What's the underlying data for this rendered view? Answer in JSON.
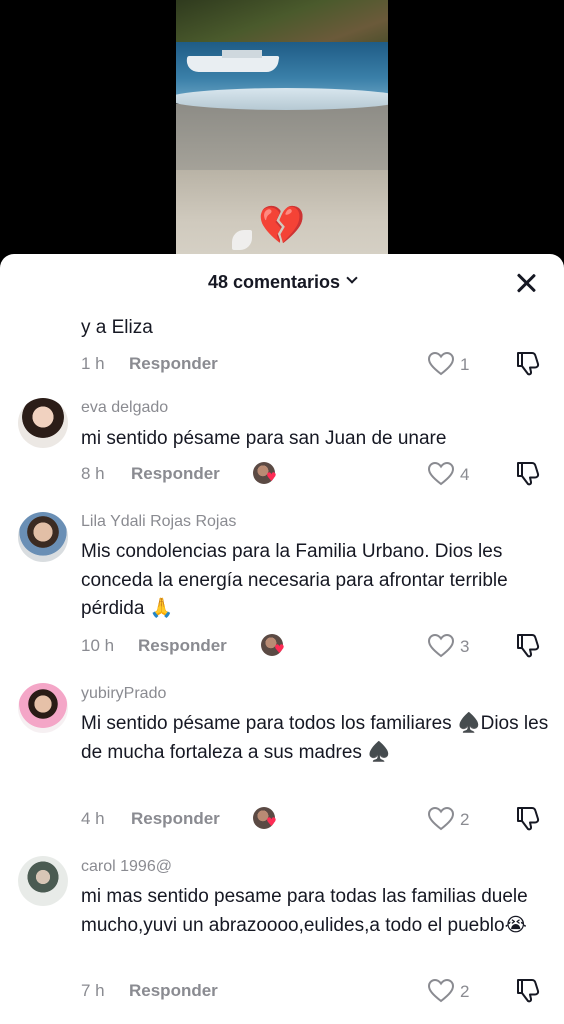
{
  "header": {
    "comment_count": "48 comentarios"
  },
  "video": {
    "overlay_emoji": "💔"
  },
  "comments": [
    {
      "username": "",
      "text": "y a Eliza",
      "time": "1 h",
      "reply": "Responder",
      "likes": "1",
      "creator_liked": false
    },
    {
      "username": "eva delgado",
      "text": "mi sentido pésame para san Juan de unare",
      "time": "8 h",
      "reply": "Responder",
      "likes": "4",
      "creator_liked": true
    },
    {
      "username": "Lila Ydali Rojas Rojas",
      "text": "Mis condolencias para la Familia Urbano. Dios les conceda la energía necesaria para afrontar terrible pérdida 🙏",
      "time": "10 h",
      "reply": "Responder",
      "likes": "3",
      "creator_liked": true
    },
    {
      "username": "yubiryPrado",
      "text": "Mi sentido pésame para todos los familiares ♠️Dios les de mucha fortaleza a sus madres ♠️",
      "time": "4 h",
      "reply": "Responder",
      "likes": "2",
      "creator_liked": true
    },
    {
      "username": "carol 1996@",
      "text": "mi mas sentido pesame para todas las familias duele mucho,yuvi un abrazoooo,eulides,a todo el pueblo😭",
      "time": "7 h",
      "reply": "Responder",
      "likes": "2",
      "creator_liked": false
    }
  ],
  "icons": {
    "like": "heart-outline-icon",
    "dislike": "thumbs-down-icon",
    "close": "close-icon"
  },
  "colors": {
    "text": "#161823",
    "muted": "#8a8b91",
    "like_red": "#fe2c55"
  }
}
